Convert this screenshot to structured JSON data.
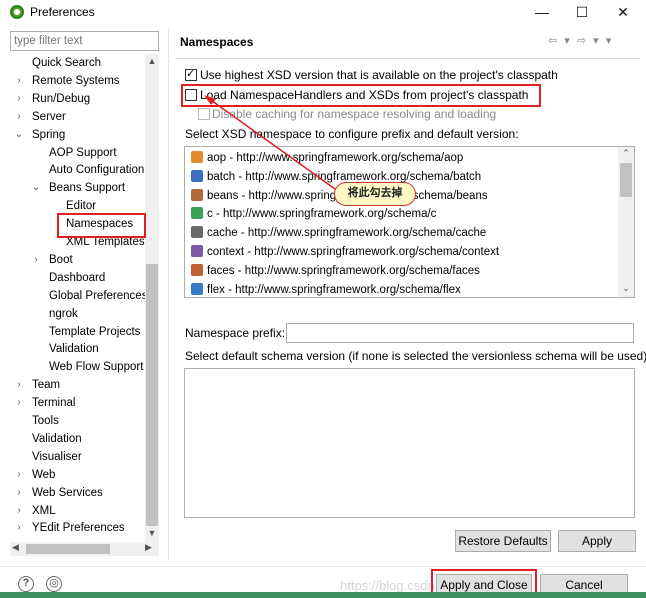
{
  "window": {
    "title": "Preferences",
    "controls": {
      "minimize": "—",
      "maximize": "☐",
      "close": "✕"
    }
  },
  "filter": {
    "placeholder": "type filter text"
  },
  "tree": [
    {
      "label": "Quick Search",
      "arrow": ""
    },
    {
      "label": "Remote Systems",
      "arrow": "›"
    },
    {
      "label": "Run/Debug",
      "arrow": "›"
    },
    {
      "label": "Server",
      "arrow": "›"
    },
    {
      "label": "Spring",
      "arrow": "⌄"
    },
    {
      "label": "AOP Support",
      "arrow": ""
    },
    {
      "label": "Auto Configuration",
      "arrow": ""
    },
    {
      "label": "Beans Support",
      "arrow": "⌄"
    },
    {
      "label": "Editor",
      "arrow": ""
    },
    {
      "label": "Namespaces",
      "arrow": ""
    },
    {
      "label": "XML Templates",
      "arrow": ""
    },
    {
      "label": "Boot",
      "arrow": "›"
    },
    {
      "label": "Dashboard",
      "arrow": ""
    },
    {
      "label": "Global Preferences",
      "arrow": ""
    },
    {
      "label": "ngrok",
      "arrow": ""
    },
    {
      "label": "Template Projects",
      "arrow": ""
    },
    {
      "label": "Validation",
      "arrow": ""
    },
    {
      "label": "Web Flow Support",
      "arrow": ""
    },
    {
      "label": "Team",
      "arrow": "›"
    },
    {
      "label": "Terminal",
      "arrow": "›"
    },
    {
      "label": "Tools",
      "arrow": ""
    },
    {
      "label": "Validation",
      "arrow": ""
    },
    {
      "label": "Visualiser",
      "arrow": ""
    },
    {
      "label": "Web",
      "arrow": "›"
    },
    {
      "label": "Web Services",
      "arrow": "›"
    },
    {
      "label": "XML",
      "arrow": "›"
    },
    {
      "label": "YEdit Preferences",
      "arrow": "›"
    }
  ],
  "page": {
    "title": "Namespaces",
    "nav": "⇦ ▾ ⇨ ▾ ▾",
    "options": {
      "use_highest": "Use highest XSD version that is available on the project's classpath",
      "load_handlers": "Load NamespaceHandlers and XSDs from project's classpath",
      "disable_caching": "Disable caching for namespace resolving and loading"
    },
    "select_label": "Select XSD namespace to configure prefix and default version:",
    "namespaces": [
      {
        "text": "aop - http://www.springframework.org/schema/aop",
        "color": "#e08a2c"
      },
      {
        "text": "batch - http://www.springframework.org/schema/batch",
        "color": "#3a6fc4"
      },
      {
        "text": "beans - http://www.springframework.org/schema/beans",
        "color": "#b06a3a"
      },
      {
        "text": "c - http://www.springframework.org/schema/c",
        "color": "#3aa05a"
      },
      {
        "text": "cache - http://www.springframework.org/schema/cache",
        "color": "#6a6a6a"
      },
      {
        "text": "context - http://www.springframework.org/schema/context",
        "color": "#7a5aa0"
      },
      {
        "text": "faces - http://www.springframework.org/schema/faces",
        "color": "#c06030"
      },
      {
        "text": "flex - http://www.springframework.org/schema/flex",
        "color": "#3a7ac0"
      }
    ],
    "prefix_label": "Namespace prefix:",
    "prefix_value": "",
    "schema_label": "Select default schema version (if none is selected the versionless schema will be used):"
  },
  "annotation": {
    "callout": "将此勾去掉"
  },
  "buttons": {
    "restore_defaults": "Restore Defaults",
    "apply": "Apply",
    "apply_close": "Apply and Close",
    "cancel": "Cancel"
  },
  "watermark": "https://blog.csdn.net/...8312",
  "colors": {
    "highlight_red": "#e02020",
    "footer_green": "#3f8f5f"
  }
}
